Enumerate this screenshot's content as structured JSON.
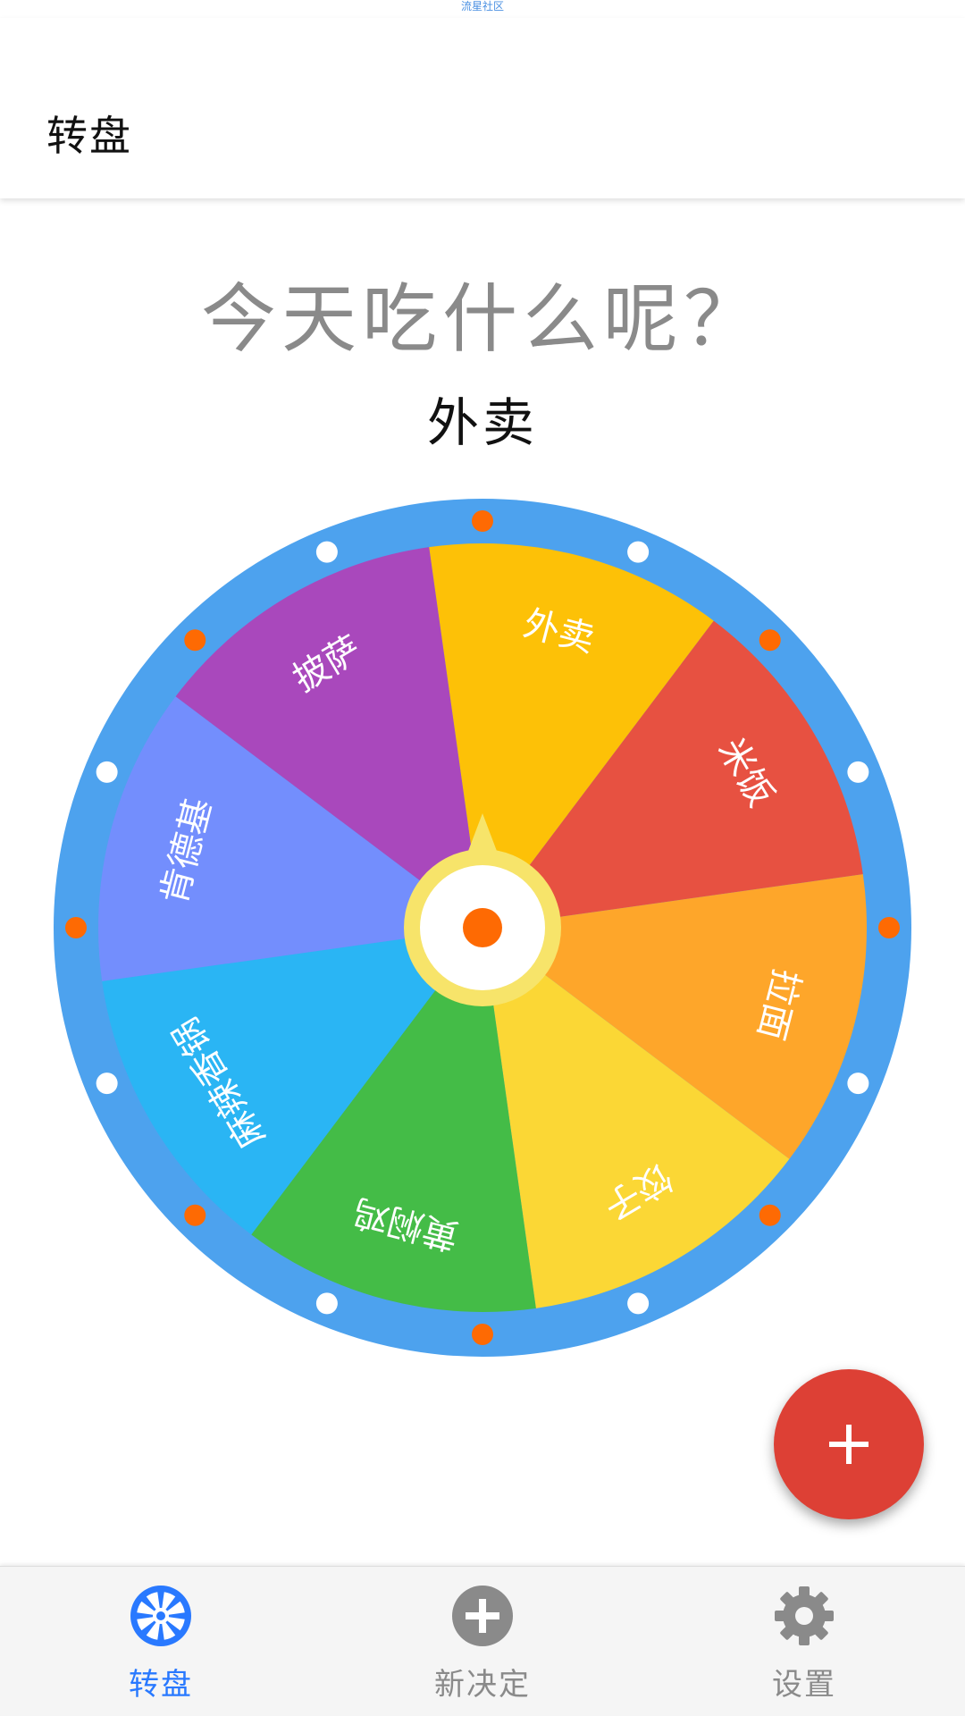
{
  "status_bar": {
    "text": "流星社区"
  },
  "app_bar": {
    "title": "转盘"
  },
  "main": {
    "question": "今天吃什么呢？",
    "result": "外卖"
  },
  "wheel": {
    "rim_color": "#4da2ee",
    "hub_ring_color": "#f7e46a",
    "center_dot_color": "#fe6a03",
    "orange_dot_color": "#fe6a03",
    "white_dot_color": "#ffffff",
    "segments": [
      {
        "label": "外卖",
        "color": "#fdc107"
      },
      {
        "label": "米饭",
        "color": "#e75141"
      },
      {
        "label": "拉面",
        "color": "#fea62a"
      },
      {
        "label": "饺子",
        "color": "#fbd735"
      },
      {
        "label": "黄焖鸡",
        "color": "#44bc47"
      },
      {
        "label": "麻辣香锅",
        "color": "#2ab5f4"
      },
      {
        "label": "肯德基",
        "color": "#738efd"
      },
      {
        "label": "披萨",
        "color": "#a948bc"
      }
    ]
  },
  "fab": {
    "icon": "plus-icon",
    "color": "#dd4035"
  },
  "bottom_nav": {
    "items": [
      {
        "label": "转盘",
        "icon": "wheel-icon",
        "active": true,
        "color": "#2979ff"
      },
      {
        "label": "新决定",
        "icon": "add-circle-icon",
        "active": false,
        "color": "#8a8a8a"
      },
      {
        "label": "设置",
        "icon": "gear-icon",
        "active": false,
        "color": "#8a8a8a"
      }
    ]
  }
}
